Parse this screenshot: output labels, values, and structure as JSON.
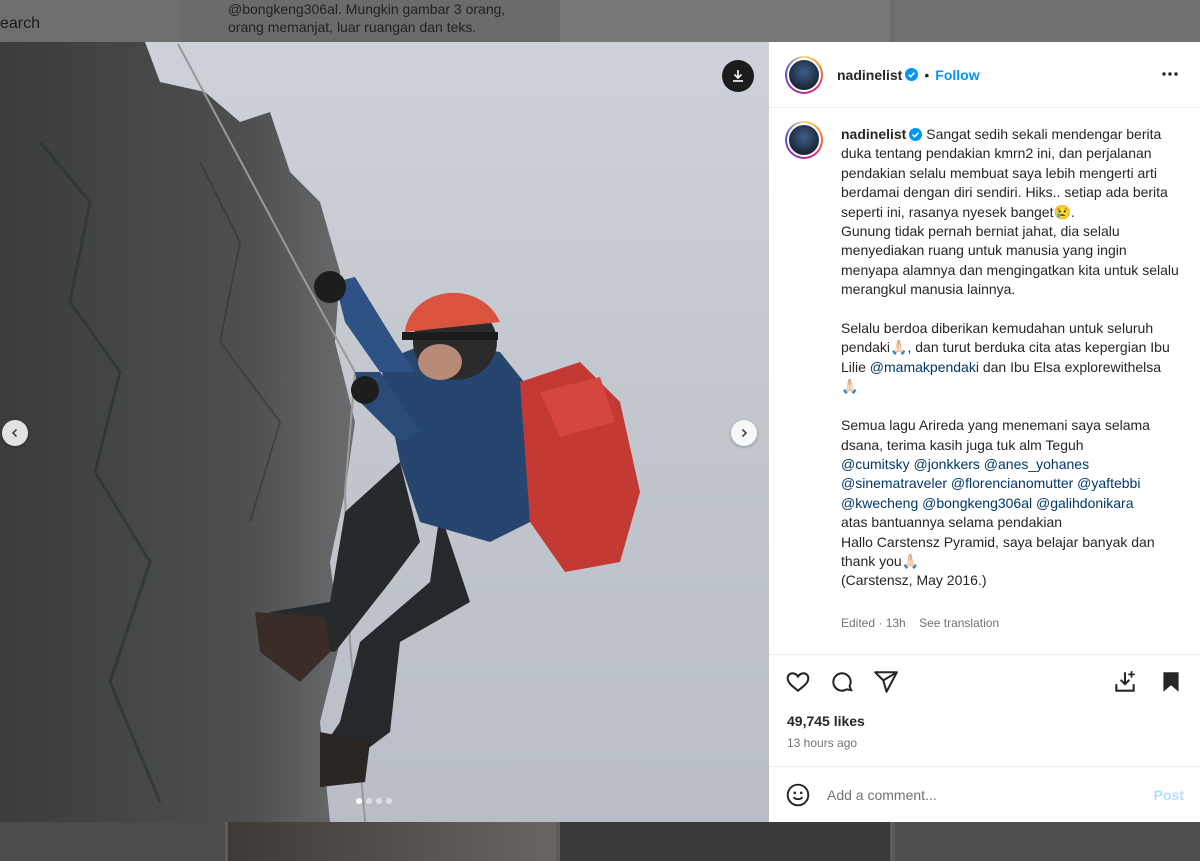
{
  "background": {
    "search_label": "earch",
    "caption_line1": "@bongkeng306al. Mungkin gambar 3 orang,",
    "caption_line2": "orang memanjat, luar ruangan dan teks."
  },
  "post": {
    "username": "nadinelist",
    "separator": "•",
    "follow_label": "Follow",
    "caption": [
      {
        "t": "Sangat sedih sekali mendengar berita duka tentang pendakian kmrn2 ini, dan perjalanan pendakian selalu membuat saya lebih mengerti arti berdamai dengan diri sendiri. Hiks.. setiap ada berita seperti ini, rasanya nyesek banget😢.\nGunung tidak pernah berniat jahat, dia selalu menyediakan ruang untuk manusia yang ingin menyapa alamnya dan mengingatkan kita untuk selalu merangkul manusia lainnya.\n\nSelalu berdoa diberikan kemudahan untuk seluruh pendaki🙏🏻, dan turut berduka cita atas kepergian Ibu Lilie ",
        "m": false
      },
      {
        "t": "@mamakpendaki",
        "m": true
      },
      {
        "t": " dan Ibu Elsa explorewithelsa 🙏🏻\n\nSemua lagu Arireda yang menemani saya selama dsana, terima kasih juga tuk alm Teguh\n",
        "m": false
      },
      {
        "t": "@cumitsky @jonkkers @anes_yohanes @sinematraveler @florencianomutter @yaftebbi @kwecheng @bongkeng306al @galihdonikara",
        "m": true
      },
      {
        "t": "\natas bantuannya selama pendakian\nHallo Carstensz Pyramid, saya belajar banyak dan thank you🙏🏻\n(Carstensz, May 2016.)",
        "m": false
      }
    ],
    "edited": "Edited · 13h",
    "see_translation": "See translation",
    "likes": "49,745 likes",
    "time_ago": "13 hours ago",
    "comment_placeholder": "Add a comment...",
    "post_label": "Post"
  },
  "colors": {
    "link": "#0095f6",
    "mention": "#00376b"
  },
  "carousel": {
    "count": 4,
    "active": 0
  }
}
